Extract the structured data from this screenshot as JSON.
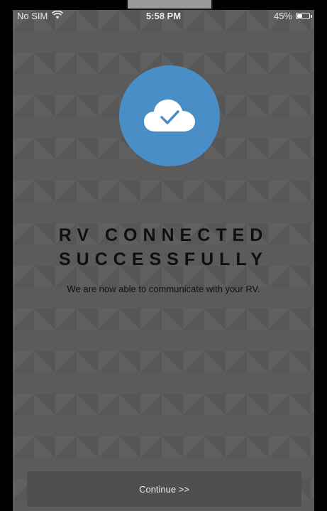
{
  "statusbar": {
    "carrier": "No SIM",
    "time": "5:58 PM",
    "battery": "45%",
    "battery_level": 0.45
  },
  "hero": {
    "icon": "cloud-check-icon",
    "circle_color": "#4a8ec7"
  },
  "title": {
    "line1": "RV CONNECTED",
    "line2": "SUCCESSFULLY"
  },
  "subtitle": "We are now able to communicate with your RV.",
  "footer": {
    "continue_label": "Continue >>"
  }
}
